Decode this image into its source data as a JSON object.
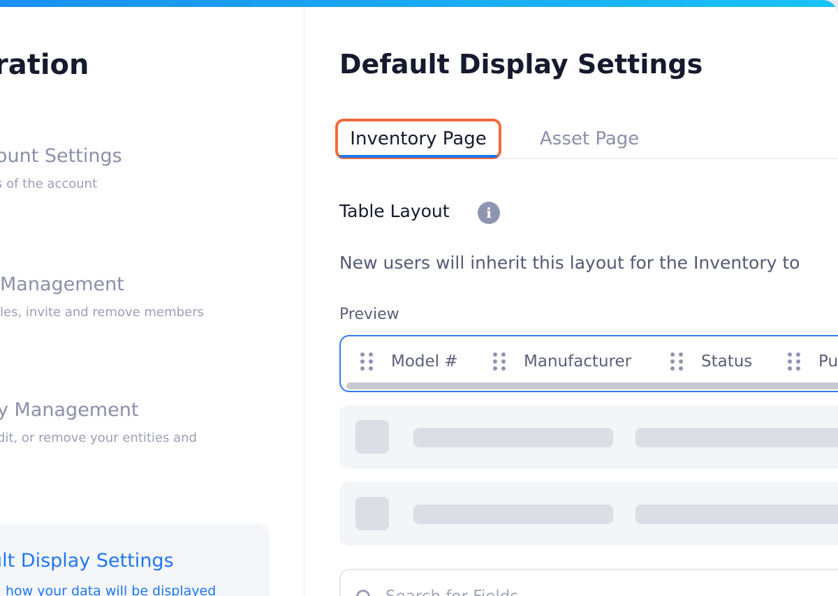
{
  "sidebar": {
    "title": "ration",
    "items": [
      {
        "label": "ount Settings",
        "description": "s of the account"
      },
      {
        "label": " Management",
        "description": "les, invite and remove members"
      },
      {
        "label": "y Management",
        "description": "dit, or remove your entities and"
      }
    ],
    "active_item": {
      "label": "ult Display Settings",
      "description": "how your data will be displayed"
    }
  },
  "main": {
    "title": "Default Display Settings",
    "tabs": [
      {
        "label": "Inventory Page",
        "active": true
      },
      {
        "label": "Asset Page",
        "active": false
      }
    ],
    "section_title": "Table Layout",
    "info_icon": "i",
    "description": "New users will inherit this layout for the Inventory to",
    "preview_label": "Preview",
    "columns": [
      "Model #",
      "Manufacturer",
      "Status",
      "Pu"
    ],
    "search": {
      "placeholder": "Search for Fields"
    }
  },
  "colors": {
    "accent": "#1e77ee",
    "highlight": "#f26b3a",
    "top_bar": "#19c3f7"
  }
}
